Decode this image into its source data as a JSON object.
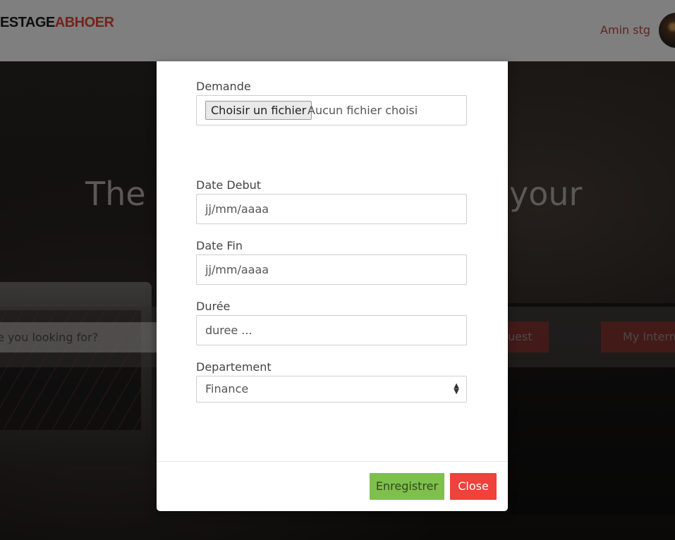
{
  "header": {
    "logo_part1": "ESTAGE",
    "logo_part2": "ABHOER",
    "user_name": "Amin stg"
  },
  "background": {
    "hero_title_left": "The I",
    "hero_title_right": "your",
    "search_placeholder": "are you looking for?",
    "request_button_label": "uest",
    "internships_button_label": "My Interns"
  },
  "modal": {
    "fields": {
      "demande": {
        "label": "Demande",
        "file_button_label": "Choisir un fichier",
        "file_status": "Aucun fichier choisi"
      },
      "date_debut": {
        "label": "Date Debut",
        "placeholder": "jj/mm/aaaa"
      },
      "date_fin": {
        "label": "Date Fin",
        "placeholder": "jj/mm/aaaa"
      },
      "duree": {
        "label": "Durée",
        "placeholder": "duree ..."
      },
      "departement": {
        "label": "Departement",
        "selected": "Finance"
      }
    },
    "footer": {
      "save_label": "Enregistrer",
      "close_label": "Close"
    }
  },
  "colors": {
    "brand_red": "#e8463b",
    "save_green": "#7fbf4d",
    "close_red": "#f0413a"
  }
}
